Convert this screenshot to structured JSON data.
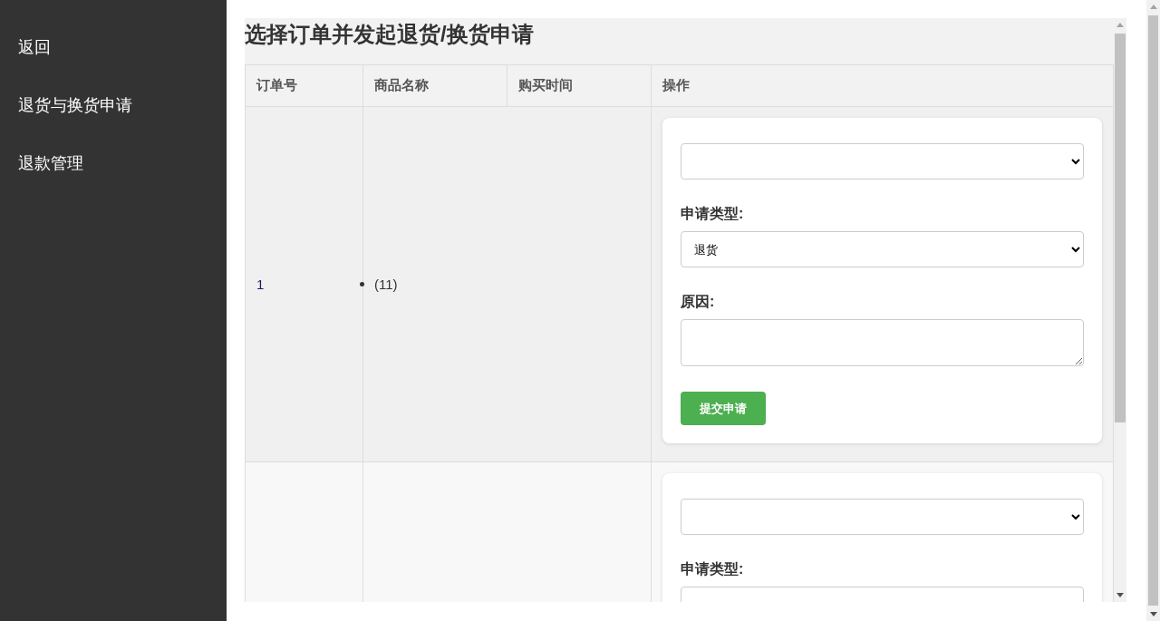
{
  "sidebar": {
    "items": [
      {
        "label": "返回"
      },
      {
        "label": "退货与换货申请"
      },
      {
        "label": "退款管理"
      }
    ]
  },
  "title": "选择订单并发起退货/换货申请",
  "table": {
    "columns": [
      "订单号",
      "商品名称",
      "购买时间",
      "操作"
    ],
    "rows": [
      {
        "order_no": "1",
        "products": [
          "(11)"
        ],
        "form": {
          "type_label": "申请类型:",
          "type_value": "退货",
          "reason_label": "原因:",
          "submit": "提交申请"
        }
      },
      {
        "form": {
          "type_label": "申请类型:"
        }
      }
    ]
  }
}
